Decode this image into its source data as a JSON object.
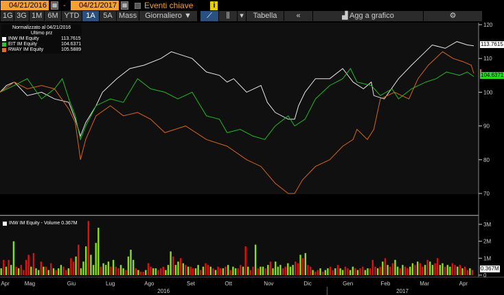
{
  "toolbar": {
    "start_date": "04/21/2016",
    "sep": "-",
    "end_date": "04/21/2017",
    "events_label": "Eventi chiave",
    "info": "i",
    "ranges": [
      "1G",
      "3G",
      "1M",
      "6M",
      "YTD",
      "1A",
      "5A",
      "Mass"
    ],
    "selected_range": "1A",
    "period": "Giornaliero ▼",
    "chart_type_line": "line-chart",
    "chart_type_candle": "candle",
    "dropdown": "▾",
    "table": "Tabella",
    "collapse": "«",
    "add_to_chart": "Agg a grafico",
    "settings": "⚙"
  },
  "legend": {
    "title": "Normalizzato al 04/21/2016",
    "subtitle": "Ultimo prz",
    "items": [
      {
        "name": "INW IM Equity",
        "value": "113.7615",
        "color": "#ffffff"
      },
      {
        "name": "EIT IM Equity",
        "value": "104.6371",
        "color": "#22cc22"
      },
      {
        "name": "RWAY IM Equity",
        "value": "105.5889",
        "color": "#e0701a"
      }
    ]
  },
  "volume_legend": "INW IM Equity - Volume 0.367M",
  "volume_tag": "0.367M",
  "chart_data": {
    "type": "line",
    "ylim": [
      63,
      121
    ],
    "yticks": [
      "120",
      "110",
      "100",
      "90",
      "80",
      "70"
    ],
    "ytick_values": [
      120,
      110,
      100,
      90,
      80,
      70
    ],
    "xlim": [
      0,
      365
    ],
    "months": [
      {
        "label": "Apr",
        "day": 4
      },
      {
        "label": "Mag",
        "day": 23
      },
      {
        "label": "Giu",
        "day": 55
      },
      {
        "label": "Lug",
        "day": 85
      },
      {
        "label": "Ago",
        "day": 115
      },
      {
        "label": "Set",
        "day": 147
      },
      {
        "label": "Ott",
        "day": 176
      },
      {
        "label": "Nov",
        "day": 207
      },
      {
        "label": "Dic",
        "day": 237
      },
      {
        "label": "Gen",
        "day": 268
      },
      {
        "label": "Feb",
        "day": 297
      },
      {
        "label": "Mar",
        "day": 327
      },
      {
        "label": "Apr",
        "day": 357
      }
    ],
    "years": [
      {
        "label": "2016",
        "day": 126
      },
      {
        "label": "2017",
        "day": 310
      }
    ],
    "year_divider_day": 252,
    "series": [
      {
        "name": "INW IM Equity",
        "color": "#e6e6e6",
        "x": [
          0,
          5,
          11,
          21,
          32,
          42,
          53,
          58,
          62,
          66,
          74,
          79,
          90,
          100,
          111,
          124,
          132,
          140,
          148,
          159,
          169,
          175,
          180,
          190,
          201,
          206,
          212,
          222,
          227,
          230,
          235,
          243,
          254,
          264,
          272,
          280,
          286,
          288,
          296,
          307,
          317,
          325,
          333,
          343,
          352,
          360,
          365
        ],
        "y": [
          100,
          102,
          103,
          99,
          100,
          98,
          97,
          92,
          87,
          91,
          96,
          100,
          104,
          107,
          108,
          110,
          112,
          111,
          110,
          106,
          105,
          103,
          104,
          100,
          102,
          97,
          94,
          92,
          92,
          96,
          100,
          104,
          104,
          107,
          103,
          101,
          103,
          99,
          98,
          104,
          108,
          111,
          114,
          113,
          115,
          114,
          113.76
        ]
      },
      {
        "name": "EIT IM Equity",
        "color": "#22bb22",
        "x": [
          0,
          11,
          21,
          32,
          42,
          48,
          53,
          58,
          62,
          66,
          74,
          85,
          95,
          106,
          116,
          127,
          137,
          148,
          159,
          169,
          175,
          185,
          195,
          204,
          212,
          222,
          227,
          235,
          243,
          254,
          264,
          270,
          275,
          286,
          293,
          302,
          307,
          317,
          328,
          336,
          344,
          354,
          360,
          365
        ],
        "y": [
          100,
          102,
          104,
          98,
          101,
          104,
          98,
          93,
          86,
          90,
          96,
          98,
          97,
          104,
          101,
          100,
          98,
          100,
          93,
          92,
          88,
          89,
          87,
          86,
          90,
          93,
          90,
          92,
          98,
          102,
          104,
          107,
          103,
          102,
          99,
          101,
          98,
          101,
          103,
          104,
          106,
          105,
          106,
          104.64
        ]
      },
      {
        "name": "RWAY IM Equity",
        "color": "#d8651a",
        "x": [
          0,
          11,
          21,
          32,
          42,
          53,
          58,
          62,
          66,
          74,
          85,
          95,
          106,
          116,
          127,
          143,
          159,
          175,
          190,
          201,
          212,
          222,
          227,
          233,
          243,
          254,
          264,
          272,
          275,
          283,
          288,
          293,
          304,
          315,
          322,
          330,
          341,
          349,
          357,
          363,
          365
        ],
        "y": [
          100,
          103,
          101,
          102,
          101,
          95,
          91,
          80,
          86,
          93,
          96,
          93,
          94,
          92,
          88,
          90,
          86,
          84,
          80,
          78,
          73,
          70,
          70,
          74,
          78,
          80,
          84,
          86,
          89,
          86,
          89,
          98,
          100,
          98,
          104,
          108,
          112,
          110,
          109,
          108,
          105.59
        ]
      }
    ],
    "volume": {
      "ylim": [
        0,
        3.3
      ],
      "yticks": [
        "3M",
        "2M",
        "1M",
        "0"
      ],
      "ytick_values": [
        3,
        2,
        1,
        0
      ],
      "values": [
        0.4,
        0.9,
        0.5,
        0.9,
        0.6,
        2.0,
        0.5,
        0.4,
        0.6,
        0.3,
        0.9,
        1.2,
        0.5,
        1.3,
        0.4,
        0.3,
        0.8,
        0.5,
        0.5,
        0.3,
        0.7,
        0.4,
        0.3,
        0.4,
        0.6,
        0.5,
        0.3,
        0.4,
        1.0,
        0.8,
        1.1,
        1.8,
        0.4,
        0.8,
        1.7,
        3.2,
        1.2,
        0.6,
        1.9,
        2.8,
        0.5,
        0.7,
        0.6,
        0.8,
        0.5,
        0.9,
        0.5,
        0.4,
        0.6,
        0.4,
        0.3,
        1.1,
        1.5,
        0.9,
        0.4,
        0.3,
        0.2,
        0.2,
        0.3,
        0.7,
        0.5,
        0.4,
        0.4,
        0.3,
        0.4,
        0.5,
        0.3,
        0.6,
        1.4,
        1.1,
        0.6,
        0.8,
        1.0,
        0.7,
        0.6,
        0.5,
        0.5,
        0.4,
        0.4,
        0.6,
        0.3,
        0.5,
        0.7,
        0.6,
        0.5,
        0.4,
        0.3,
        0.5,
        0.4,
        0.4,
        0.5,
        0.6,
        0.3,
        0.5,
        0.4,
        0.4,
        0.6,
        0.5,
        1.7,
        0.5,
        0.3,
        0.5,
        1.8,
        0.4,
        0.5,
        0.5,
        0.4,
        0.6,
        0.8,
        0.4,
        0.8,
        0.5,
        0.6,
        0.4,
        0.5,
        0.7,
        0.5,
        0.6,
        0.8,
        0.7,
        1.2,
        1.0,
        1.3,
        0.6,
        0.5,
        0.3,
        0.2,
        0.3,
        0.4,
        0.2,
        0.3,
        0.4,
        0.5,
        0.3,
        0.4,
        0.6,
        0.4,
        0.3,
        0.5,
        0.4,
        0.3,
        0.5,
        0.4,
        0.3,
        0.4,
        0.5,
        0.3,
        0.4,
        0.4,
        0.9,
        0.5,
        0.4,
        0.5,
        0.8,
        1.0,
        0.6,
        0.5,
        0.7,
        0.9,
        0.5,
        0.4,
        0.6,
        0.5,
        0.4,
        0.5,
        0.7,
        0.6,
        0.8,
        0.7,
        0.5,
        0.6,
        0.9,
        0.8,
        0.6,
        0.7,
        1.0,
        0.6,
        0.7,
        0.5,
        0.6,
        0.5,
        0.7,
        0.6,
        0.5,
        0.6,
        0.4,
        0.5,
        0.3,
        0.4,
        0.3
      ],
      "dir": "GRGRGGRGRRRRGRGGRGRGRGRGGRRGRRGRGGGRGGGGRGGGRGRRGGRGGGRGRRGRRGGRRRGGGRGGRGRGRRGGRGRRGRGRRGRGRGGRRGRGRRGRGGRGRGGGGRRGGGRRGRGRRGRRGRGGRRGRGGRRGGRGRRGGRRRGRGRGRRGGRGRRGGRGRRGRGGRRGGRGGRRGRGRRGRGR"
    }
  }
}
